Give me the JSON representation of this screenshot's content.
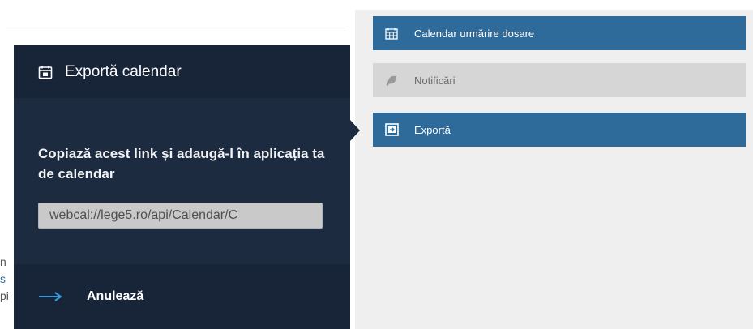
{
  "background": {
    "edge_text": [
      "n",
      "s",
      "pi"
    ]
  },
  "side_menu": {
    "items": [
      {
        "label": "Calendar urmărire dosare",
        "icon": "calendar-grid-icon",
        "state": "active"
      },
      {
        "label": "Notificări",
        "icon": "bell-icon",
        "state": "muted"
      },
      {
        "label": "Exportă",
        "icon": "export-icon",
        "state": "active"
      }
    ]
  },
  "popover": {
    "title": "Exportă calendar",
    "title_icon": "calendar-icon",
    "instruction": "Copiază acest link și adaugă-l în aplicația ta de calendar",
    "link_value": "webcal://lege5.ro/api/Calendar/C",
    "cancel_label": "Anulează",
    "cancel_icon": "arrow-right-icon"
  },
  "colors": {
    "popover_bg": "#1d2b40",
    "menu_active": "#2e6b9a",
    "menu_muted": "#d6d6d6",
    "arrow_accent": "#3a9ad9"
  }
}
